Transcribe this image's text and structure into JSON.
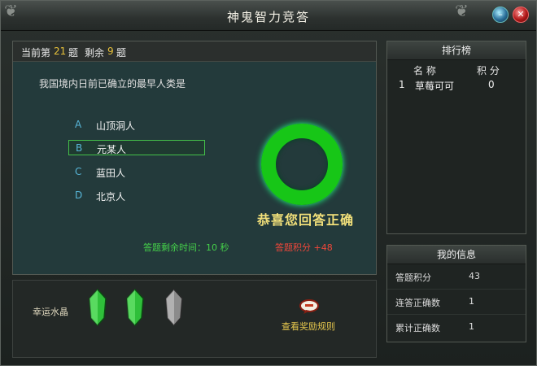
{
  "window": {
    "title": "神鬼智力竞答"
  },
  "question_panel": {
    "current_prefix": "当前第",
    "current_num": "21",
    "current_suffix": "题",
    "remaining_prefix": "剩余",
    "remaining_num": "9",
    "remaining_suffix": "题",
    "question": "我国境内日前已确立的最早人类是",
    "options": [
      {
        "letter": "A",
        "text": "山顶洞人"
      },
      {
        "letter": "B",
        "text": "元某人"
      },
      {
        "letter": "C",
        "text": "蓝田人"
      },
      {
        "letter": "D",
        "text": "北京人"
      }
    ],
    "selected_option": "B",
    "result_text": "恭喜您回答正确",
    "time_text": "答题剩余时间：10 秒",
    "score_text": "答题积分 +48"
  },
  "crystals": {
    "label": "幸运水晶",
    "items": [
      {
        "color": "#3fd24a",
        "state": "active"
      },
      {
        "color": "#3fd24a",
        "state": "active"
      },
      {
        "color": "#9a9a9a",
        "state": "used"
      }
    ],
    "rules_label": "查看奖励规则"
  },
  "leaderboard": {
    "title": "排行榜",
    "col_name": "名 称",
    "col_score": "积 分",
    "rows": [
      {
        "rank": "1",
        "name": "草莓可可",
        "score": "0"
      }
    ]
  },
  "my_info": {
    "title": "我的信息",
    "rows": [
      {
        "label": "答题积分",
        "value": "43"
      },
      {
        "label": "连答正确数",
        "value": "1"
      },
      {
        "label": "累计正确数",
        "value": "1"
      }
    ]
  },
  "colors": {
    "accent_green": "#17c617",
    "highlight_yellow": "#e8c23a",
    "score_red": "#f0473a"
  }
}
